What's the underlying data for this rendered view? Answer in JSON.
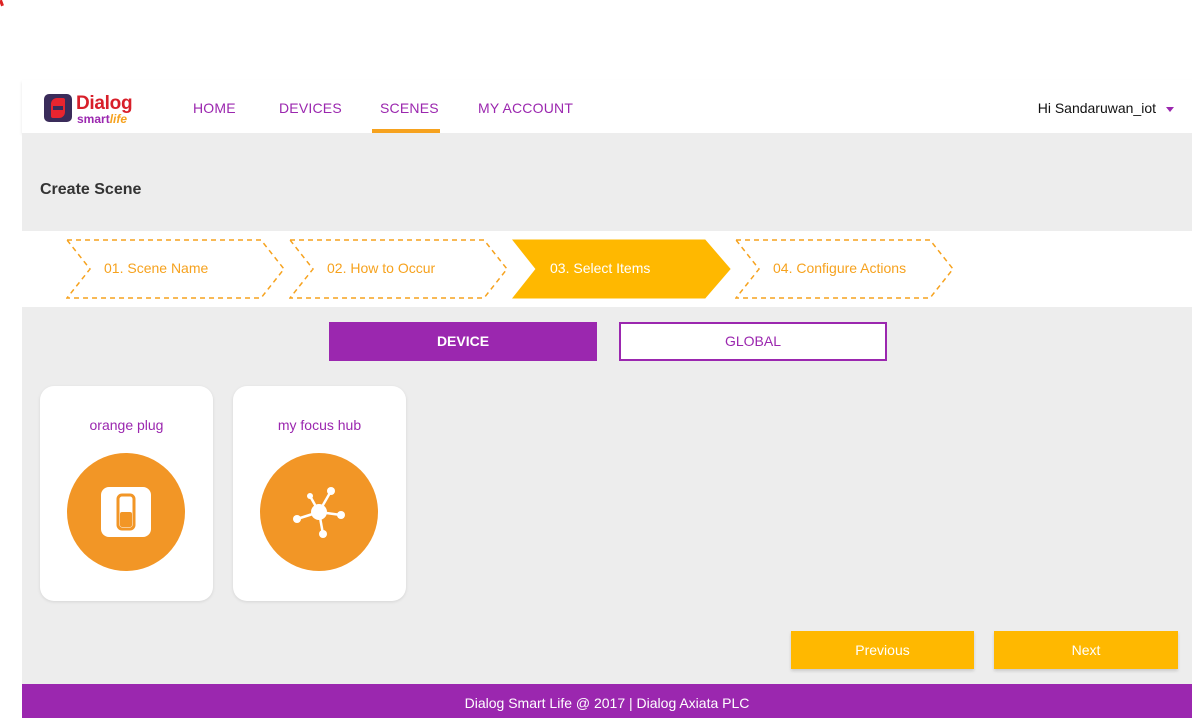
{
  "brand": {
    "name_line1": "Dialog",
    "name_line2_a": "smart",
    "name_line2_b": "life"
  },
  "nav": {
    "items": [
      {
        "label": "HOME"
      },
      {
        "label": "DEVICES"
      },
      {
        "label": "SCENES"
      },
      {
        "label": "MY ACCOUNT"
      }
    ],
    "active": "SCENES"
  },
  "user": {
    "greeting": "Hi Sandaruwan_iot"
  },
  "page": {
    "title": "Create Scene"
  },
  "steps": [
    {
      "label": "01. Scene Name",
      "active": false
    },
    {
      "label": "02. How to Occur",
      "active": false
    },
    {
      "label": "03. Select Items",
      "active": true
    },
    {
      "label": "04. Configure Actions",
      "active": false
    }
  ],
  "tabs": {
    "device": "DEVICE",
    "global": "GLOBAL",
    "selected": "DEVICE"
  },
  "devices": [
    {
      "name": "orange plug",
      "icon": "smart-plug-icon"
    },
    {
      "name": "my focus hub",
      "icon": "hub-network-icon"
    }
  ],
  "buttons": {
    "previous": "Previous",
    "next": "Next"
  },
  "footer": {
    "text": "Dialog Smart Life @ 2017 | Dialog Axiata PLC"
  },
  "colors": {
    "purple": "#9b27af",
    "orange": "#f6a21e",
    "yellow": "#ffb800",
    "device_circle": "#f29626"
  }
}
